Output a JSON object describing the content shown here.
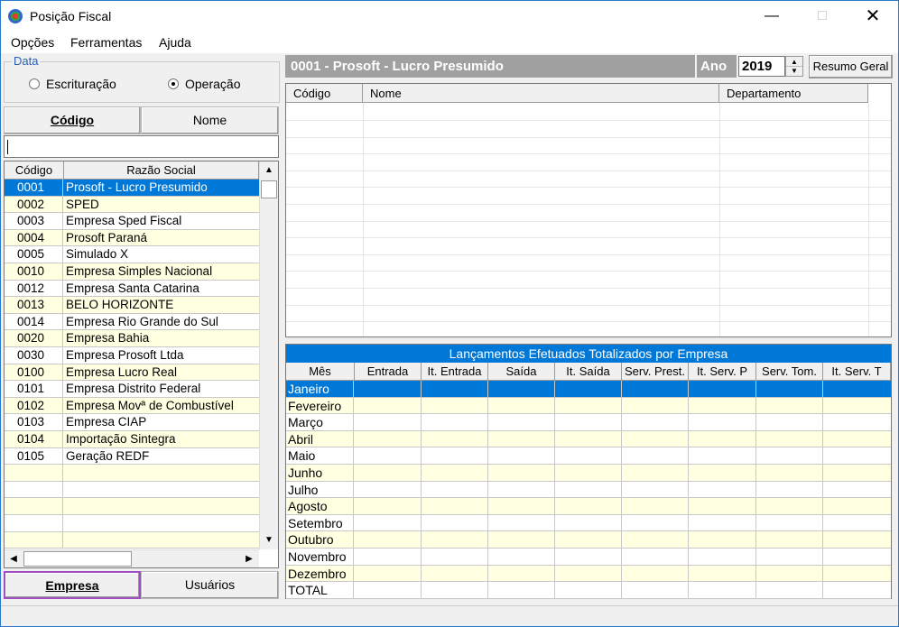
{
  "window": {
    "title": "Posição Fiscal",
    "minimize_icon": "minimize-icon",
    "maximize_icon": "maximize-icon",
    "close_icon": "close-icon"
  },
  "menu": {
    "items": [
      "Opções",
      "Ferramentas",
      "Ajuda"
    ]
  },
  "data_group": {
    "legend": "Data",
    "options": [
      {
        "label": "Escrituração",
        "checked": false
      },
      {
        "label": "Operação",
        "checked": true
      }
    ]
  },
  "sort_tabs": {
    "codigo": "Código",
    "nome": "Nome"
  },
  "filter": {
    "value": ""
  },
  "company_list": {
    "headers": [
      "Código",
      "Razão Social"
    ],
    "rows": [
      [
        "0001",
        "Prosoft - Lucro Presumido"
      ],
      [
        "0002",
        "SPED"
      ],
      [
        "0003",
        "Empresa Sped Fiscal"
      ],
      [
        "0004",
        "Prosoft Paraná"
      ],
      [
        "0005",
        "Simulado X"
      ],
      [
        "0010",
        "Empresa Simples Nacional"
      ],
      [
        "0012",
        "Empresa Santa Catarina"
      ],
      [
        "0013",
        "BELO HORIZONTE"
      ],
      [
        "0014",
        "Empresa Rio Grande do Sul"
      ],
      [
        "0020",
        "Empresa Bahia"
      ],
      [
        "0030",
        "Empresa  Prosoft Ltda"
      ],
      [
        "0100",
        "Empresa Lucro Real"
      ],
      [
        "0101",
        "Empresa Distrito Federal"
      ],
      [
        "0102",
        "Empresa Movª de Combustível"
      ],
      [
        "0103",
        "Empresa CIAP"
      ],
      [
        "0104",
        "Importação Sintegra"
      ],
      [
        "0105",
        "Geração REDF"
      ]
    ]
  },
  "bottom_tabs": {
    "empresa": "Empresa",
    "usuarios": "Usuários"
  },
  "header": {
    "company": "0001 - Prosoft - Lucro Presumido",
    "ano_label": "Ano",
    "ano_value": "2019",
    "resumo_button": "Resumo Geral"
  },
  "users_grid": {
    "headers": [
      "Código",
      "Nome",
      "Departamento"
    ]
  },
  "totals_grid": {
    "title": "Lançamentos Efetuados Totalizados por Empresa",
    "headers": [
      "Mês",
      "Entrada",
      "It. Entrada",
      "Saída",
      "It. Saída",
      "Serv. Prest.",
      "It. Serv. P",
      "Serv. Tom.",
      "It. Serv. T"
    ],
    "months": [
      "Janeiro",
      "Fevereiro",
      "Março",
      "Abril",
      "Maio",
      "Junho",
      "Julho",
      "Agosto",
      "Setembro",
      "Outubro",
      "Novembro",
      "Dezembro",
      "TOTAL"
    ]
  },
  "colors": {
    "selection": "#0078d7",
    "alt_row": "#ffffe1",
    "header_gray": "#a0a0a0",
    "highlight_border": "#a04fc0"
  }
}
